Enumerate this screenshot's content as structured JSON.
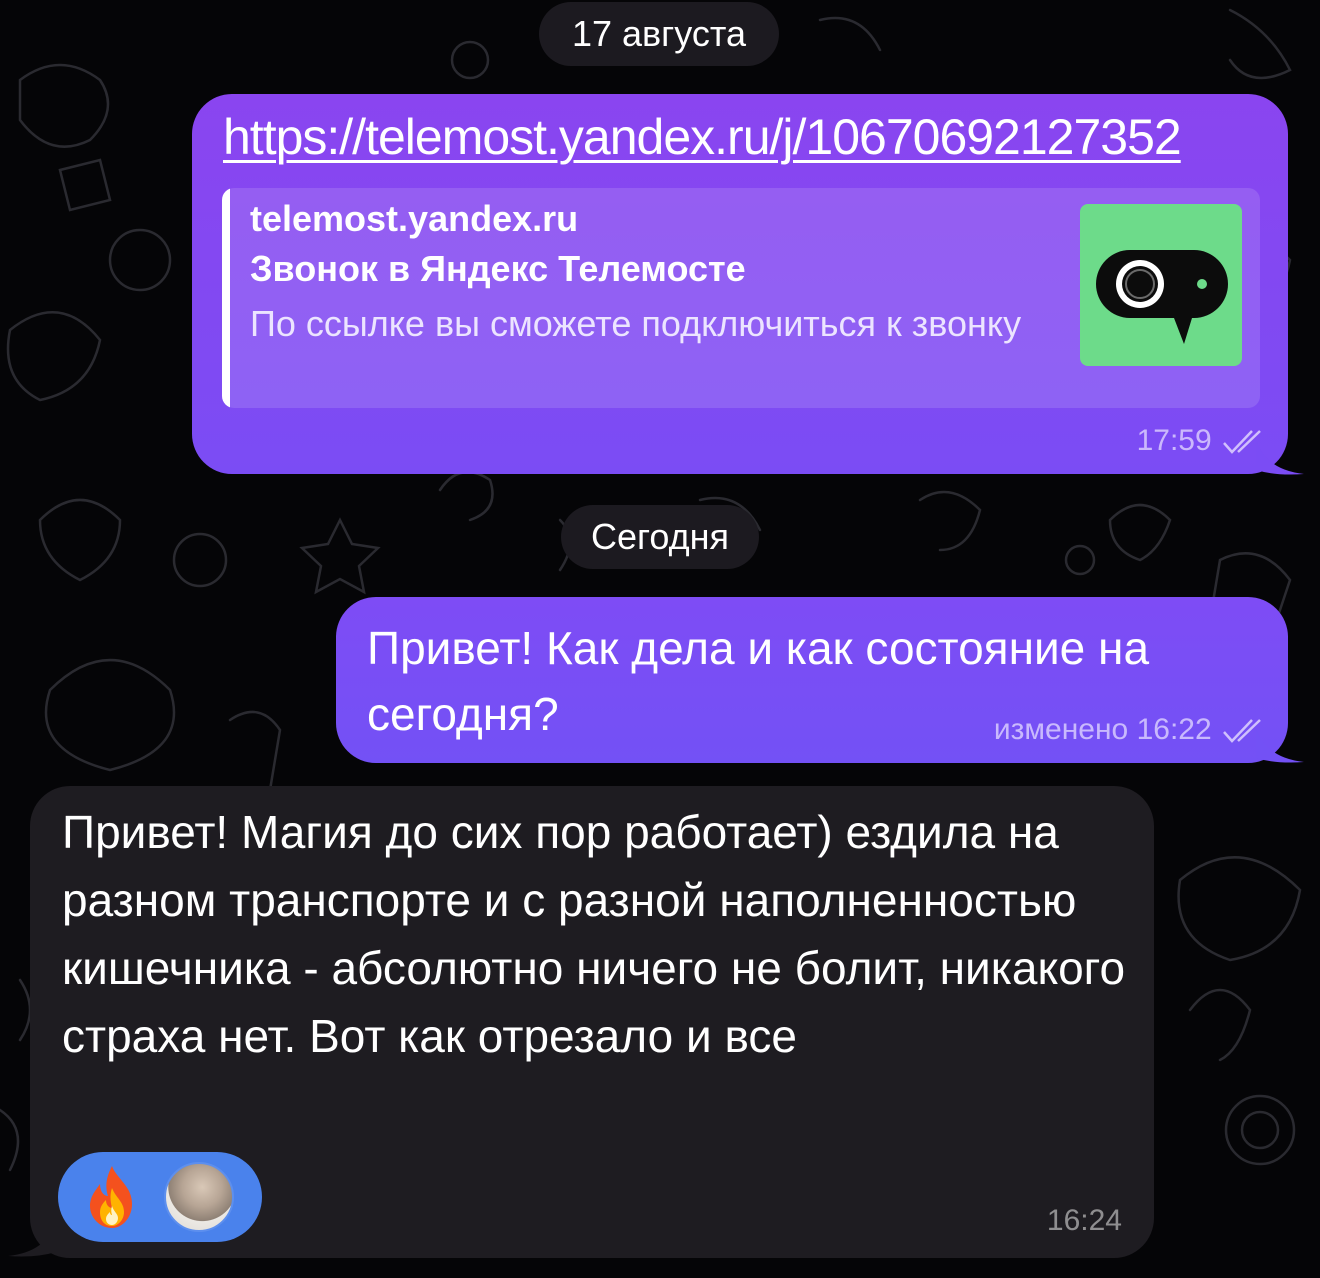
{
  "chat": {
    "date_separators": [
      "17 августа",
      "Сегодня"
    ],
    "messages": [
      {
        "direction": "outgoing",
        "link": "https://telemost.yandex.ru/j/10670692127352",
        "preview": {
          "site": "telemost.yandex.ru",
          "title": "Звонок в Яндекс Телемосте",
          "description": "По ссылке вы сможете подключиться к звонку",
          "thumbnail_icon": "telemost-camera-icon"
        },
        "time": "17:59",
        "status": "read"
      },
      {
        "direction": "outgoing",
        "text": "Привет! Как дела и как состояние на сегодня?",
        "edited_label": "изменено",
        "time": "16:22",
        "status": "read"
      },
      {
        "direction": "incoming",
        "text": "Привет! Магия до сих пор работает) ездила на разном транспорте и с разной наполненностью кишечника - абсолютно ничего не болит, никакого страха нет. Вот как отрезало и все",
        "reactions": {
          "emoji": "🔥",
          "reactor_avatar": "user-avatar"
        },
        "time": "16:24"
      }
    ]
  },
  "colors": {
    "background": "#050507",
    "outgoing_bubble": "#8a45f0",
    "incoming_bubble": "#1e1c21",
    "reaction_pill": "#4a82ec",
    "thumbnail_bg": "#6ddb8a"
  }
}
